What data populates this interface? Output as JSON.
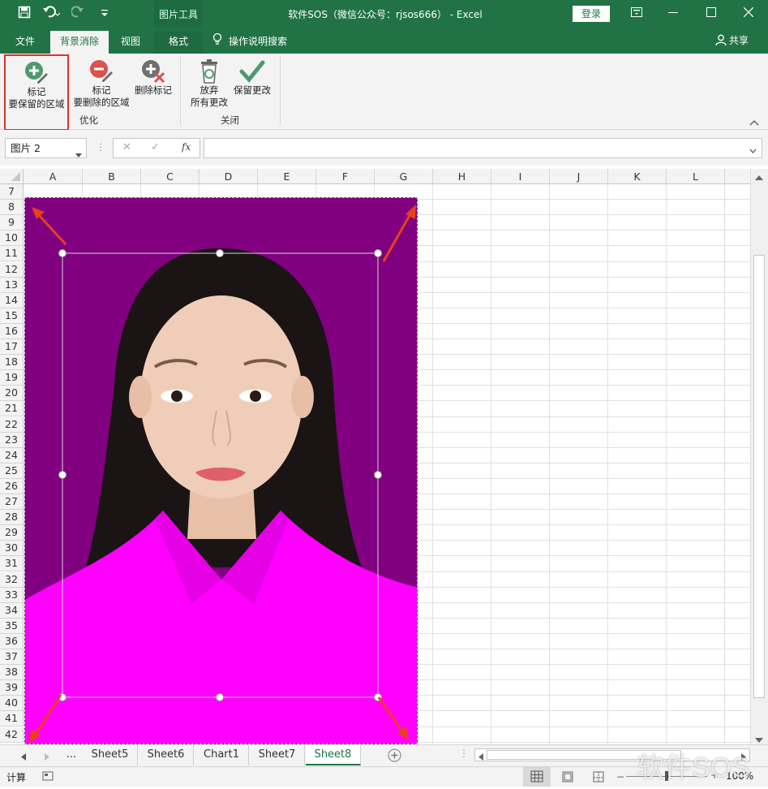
{
  "title_bar": {
    "context_tools": "图片工具",
    "window_title": "软件SOS（微信公众号：rjsos666） - Excel",
    "login": "登录"
  },
  "tabs": {
    "file": "文件",
    "bg_remove": "背景消除",
    "view": "视图",
    "format": "格式",
    "search": "操作说明搜索",
    "share": "共享"
  },
  "ribbon": {
    "mark_keep_line1": "标记",
    "mark_keep_line2": "要保留的区域",
    "mark_remove_line1": "标记",
    "mark_remove_line2": "要删除的区域",
    "delete_mark": "删除标记",
    "group_refine": "优化",
    "discard_line1": "放弃",
    "discard_line2": "所有更改",
    "keep_changes": "保留更改",
    "group_close": "关闭"
  },
  "formula_bar": {
    "name_box": "图片 2",
    "fx": "fx",
    "value": ""
  },
  "columns": [
    "A",
    "B",
    "C",
    "D",
    "E",
    "F",
    "G",
    "H",
    "I",
    "J",
    "K",
    "L"
  ],
  "rows": [
    "7",
    "8",
    "9",
    "10",
    "11",
    "12",
    "13",
    "14",
    "15",
    "16",
    "17",
    "18",
    "19",
    "20",
    "21",
    "22",
    "23",
    "24",
    "25",
    "26",
    "27",
    "28",
    "29",
    "30",
    "31",
    "32",
    "33",
    "34",
    "35",
    "36",
    "37",
    "38",
    "39",
    "40",
    "41",
    "42"
  ],
  "sheet_tabs": {
    "ellipsis": "...",
    "tabs": [
      "Sheet5",
      "Sheet6",
      "Chart1",
      "Sheet7",
      "Sheet8"
    ],
    "active": "Sheet8"
  },
  "status_bar": {
    "mode": "计算",
    "zoom": "100%"
  },
  "watermark": "软件SOS",
  "colors": {
    "excel_green": "#217346",
    "removed_background": "#800080",
    "shirt": "#ff00ff",
    "arrow": "#e8401c"
  }
}
